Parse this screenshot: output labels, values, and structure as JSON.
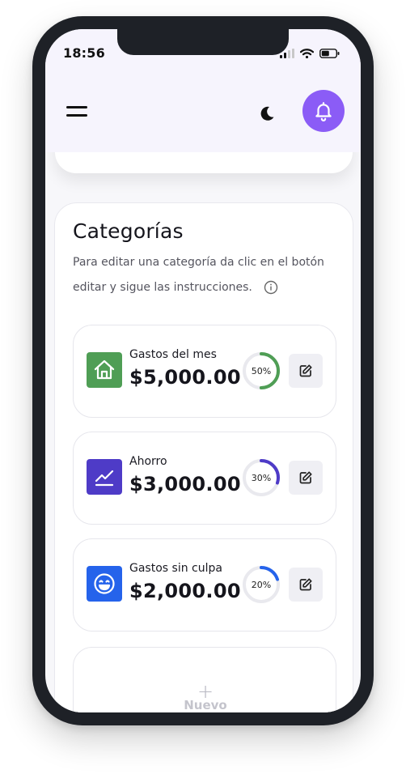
{
  "status": {
    "time": "18:56"
  },
  "colors": {
    "accent": "#8b5cf6",
    "green": "#4f9e55",
    "indigo": "#4e3bc7",
    "blue": "#2563eb"
  },
  "header": {
    "menu_icon": "hamburger-icon",
    "theme_icon": "moon-icon",
    "notification_icon": "bell-icon"
  },
  "categories": {
    "title": "Categorías",
    "description": "Para editar una categoría da clic en el botón editar y sigue las instrucciones.",
    "items": [
      {
        "label": "Gastos del mes",
        "amount": "$5,000.00",
        "percent_label": "50%",
        "percent": 50,
        "icon": "home-icon",
        "color": "#4f9e55"
      },
      {
        "label": "Ahorro",
        "amount": "$3,000.00",
        "percent_label": "30%",
        "percent": 30,
        "icon": "trend-up-icon",
        "color": "#4e3bc7"
      },
      {
        "label": "Gastos sin culpa",
        "amount": "$2,000.00",
        "percent_label": "20%",
        "percent": 20,
        "icon": "smile-icon",
        "color": "#2563eb"
      }
    ],
    "new_label": "Nuevo"
  }
}
